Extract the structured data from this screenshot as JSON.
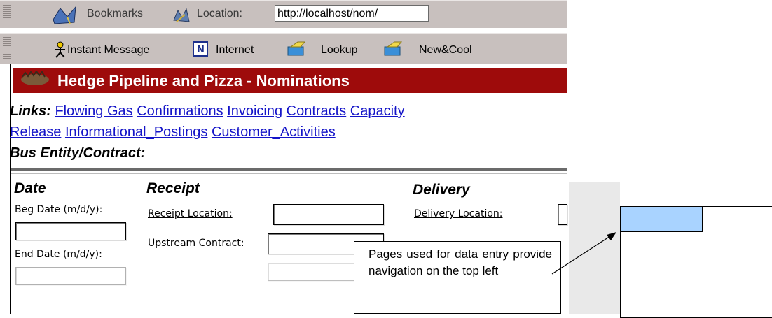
{
  "browser": {
    "bookmarks_label": "Bookmarks",
    "location_label": "Location:",
    "url": "http://localhost/nom/",
    "personal_toolbar": [
      "Instant Message",
      "Internet",
      "Lookup",
      "New&Cool"
    ]
  },
  "app": {
    "title": "Hedge Pipeline and Pizza - Nominations",
    "links_label": "Links:",
    "links": [
      "Flowing Gas",
      "Confirmations",
      "Invoicing",
      "Contracts",
      "Capacity Release",
      "Informational_Postings",
      "Customer_Activities"
    ],
    "links_row1": [
      "Flowing Gas",
      "Confirmations",
      "Invoicing",
      "Contracts",
      "Capacity"
    ],
    "links_row2": [
      "Release",
      "Informational_Postings",
      "Customer_Activities"
    ],
    "bus_entity_label": "Bus Entity/Contract:",
    "date": {
      "heading": "Date",
      "beg_label": "Beg Date (m/d/y):",
      "end_label": "End Date (m/d/y):"
    },
    "receipt": {
      "heading": "Receipt",
      "location_link": "Receipt Location:",
      "upstream_label": "Upstream Contract:"
    },
    "delivery": {
      "heading": "Delivery",
      "location_link": "Delivery Location:"
    }
  },
  "annotation": {
    "callout_text": "Pages used for data entry provide navigation on the top left"
  },
  "colors": {
    "toolbar": "#c8c0be",
    "title_bar": "#9e0b0b",
    "link": "#1414c8",
    "placeholder_tab": "#a9d3ff"
  }
}
